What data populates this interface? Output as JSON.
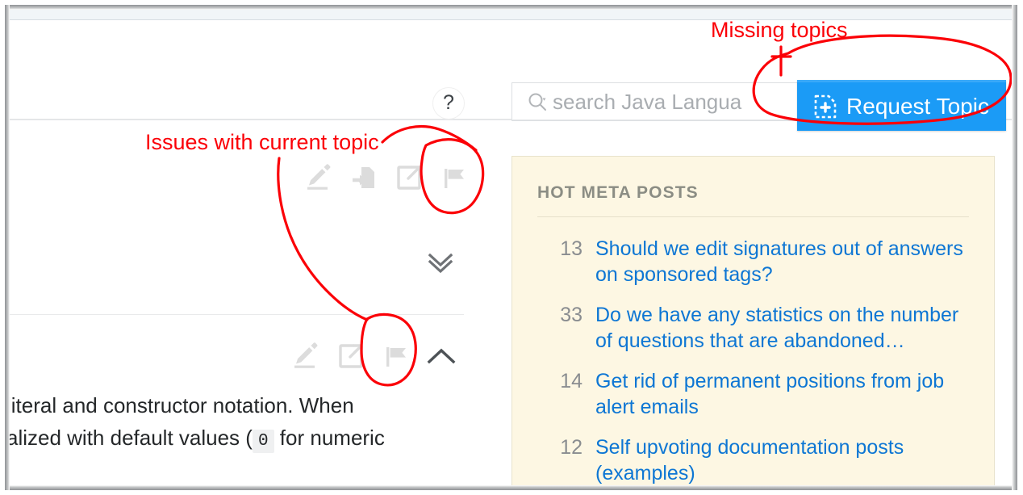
{
  "window": {
    "accent_blue": "#1b9bf6",
    "annotation_red": "#fb0007",
    "sidebar_bg": "#fdf7e3",
    "link_blue": "#0d76d4"
  },
  "header": {
    "help_icon_label": "?",
    "search": {
      "placeholder": "search Java Langua",
      "value": "",
      "icon": "search-icon"
    },
    "request_topic": {
      "label": "Request Topic",
      "icon": "document-plus-icon"
    }
  },
  "post_actions_top": [
    {
      "name": "edit",
      "icon": "pencil-icon"
    },
    {
      "name": "move",
      "icon": "document-arrow-icon"
    },
    {
      "name": "share",
      "icon": "external-link-icon"
    },
    {
      "name": "flag",
      "icon": "flag-icon"
    }
  ],
  "post_actions_lower": [
    {
      "name": "edit",
      "icon": "pencil-icon"
    },
    {
      "name": "share",
      "icon": "external-link-icon"
    },
    {
      "name": "flag",
      "icon": "flag-icon"
    }
  ],
  "collapse_controls": {
    "expand_all": "chevron-double-down-icon",
    "collapse": "chevron-up-icon"
  },
  "body": {
    "line1": "literal and constructor notation. When",
    "line2_before": "alized with default values (",
    "code": "0",
    "line2_after": "for numeric"
  },
  "sidebar": {
    "title": "HOT META POSTS",
    "posts": [
      {
        "score": "13",
        "title": "Should we edit signatures out of answers on sponsored tags?"
      },
      {
        "score": "33",
        "title": "Do we have any statistics on the number of questions that are abandoned…"
      },
      {
        "score": "14",
        "title": "Get rid of permanent positions from job alert emails"
      },
      {
        "score": "12",
        "title": "Self upvoting documentation posts (examples)"
      }
    ]
  },
  "annotations": [
    {
      "id": "missing-topics",
      "text": "Missing topics"
    },
    {
      "id": "issues-topic",
      "text": "Issues with current topic"
    }
  ]
}
